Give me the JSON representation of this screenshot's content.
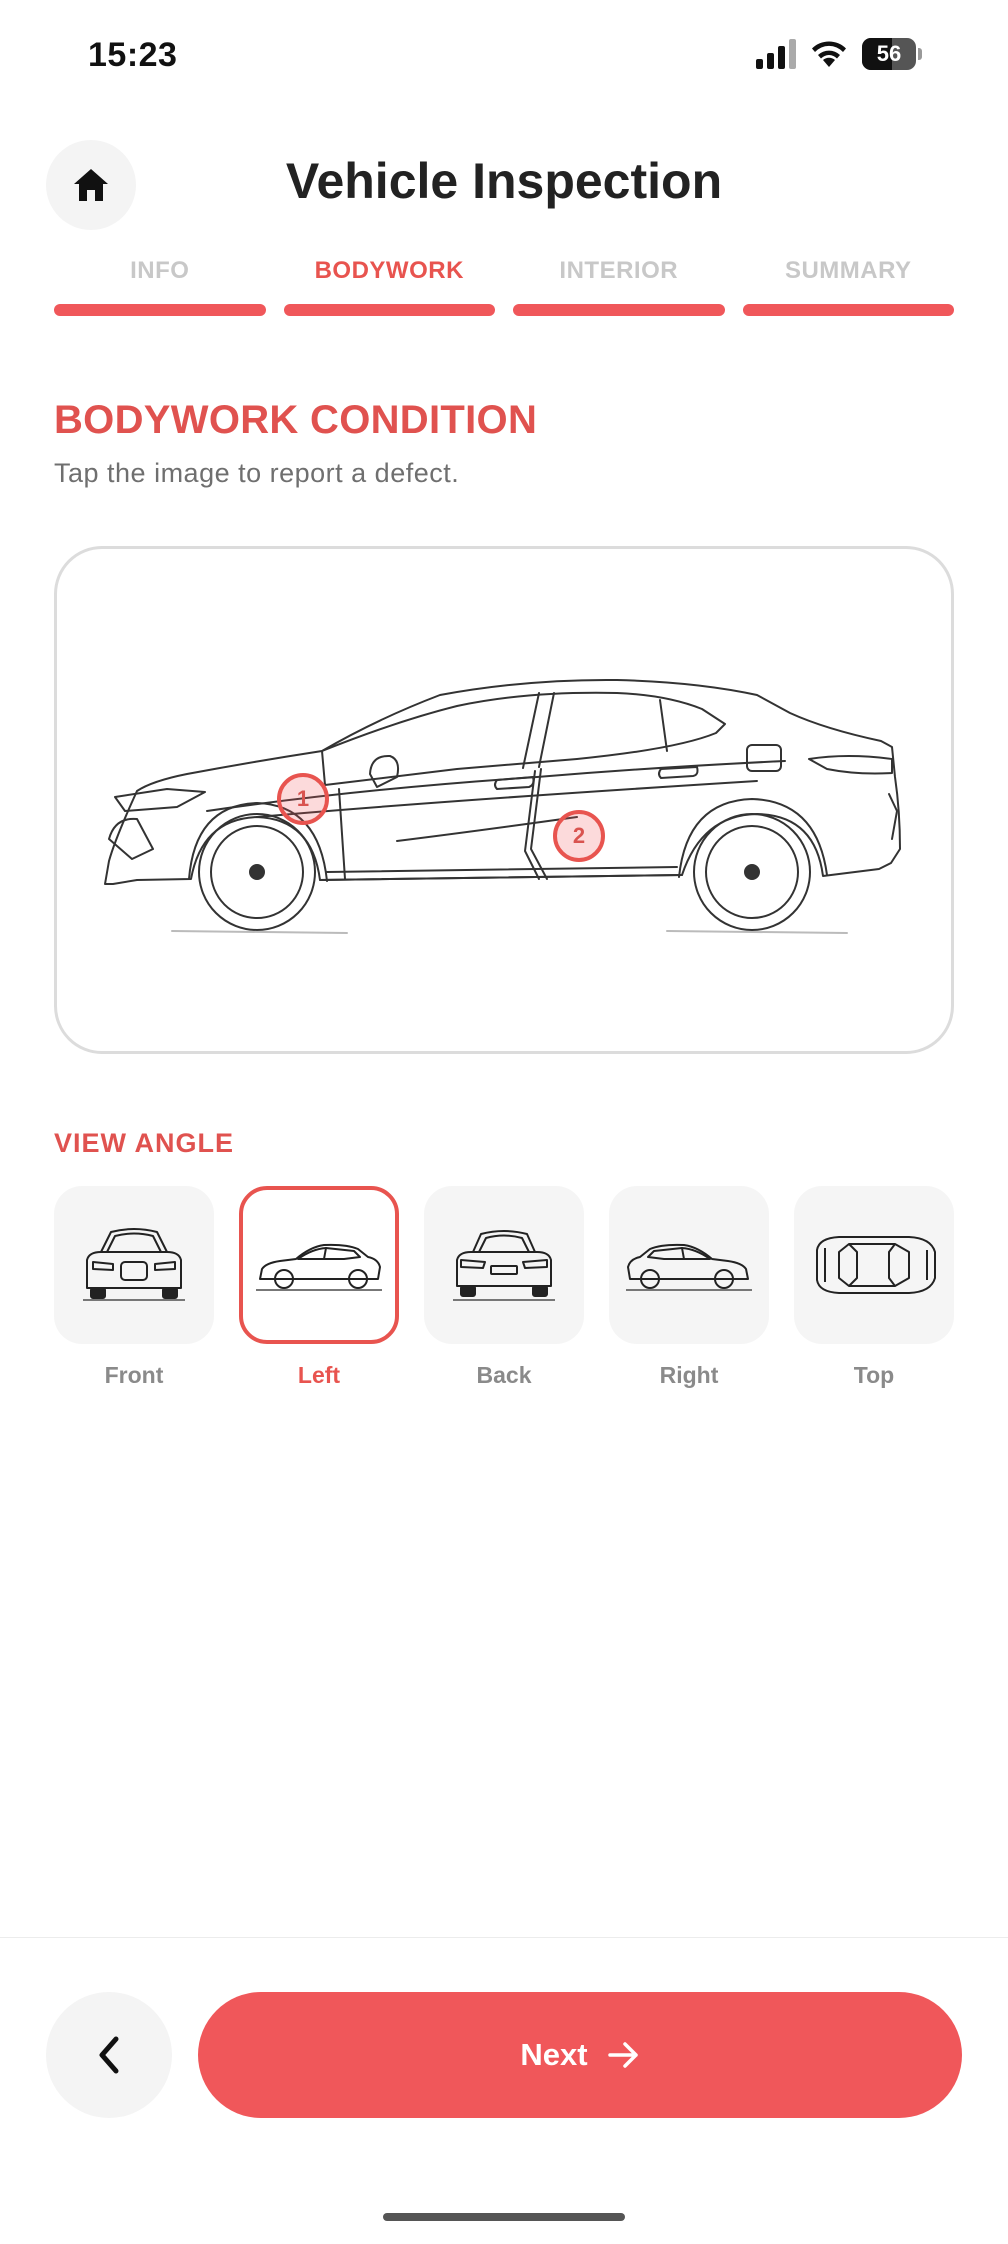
{
  "status_bar": {
    "time": "15:23",
    "battery_level": "56",
    "battery_percent": 56,
    "icons": [
      "signal-icon",
      "wifi-icon",
      "battery-icon"
    ]
  },
  "header": {
    "title": "Vehicle Inspection",
    "home_icon": "home-icon"
  },
  "steps": [
    {
      "label": "INFO",
      "active": false
    },
    {
      "label": "BODYWORK",
      "active": true
    },
    {
      "label": "INTERIOR",
      "active": false
    },
    {
      "label": "SUMMARY",
      "active": false
    }
  ],
  "section": {
    "title": "BODYWORK CONDITION",
    "subtitle": "Tap the image to report a defect."
  },
  "defects": [
    {
      "number": "1"
    },
    {
      "number": "2"
    }
  ],
  "view_angle": {
    "title": "VIEW ANGLE",
    "options": [
      {
        "label": "Front",
        "selected": false
      },
      {
        "label": "Left",
        "selected": true
      },
      {
        "label": "Back",
        "selected": false
      },
      {
        "label": "Right",
        "selected": false
      },
      {
        "label": "Top",
        "selected": false
      }
    ]
  },
  "footer": {
    "next_label": "Next",
    "back_icon": "chevron-left-icon",
    "next_icon": "arrow-right-icon"
  },
  "colors": {
    "accent": "#f0575a",
    "accent_text": "#e0524f",
    "inactive_step": "#c8c8c8",
    "card_border": "#dcdcdc"
  }
}
